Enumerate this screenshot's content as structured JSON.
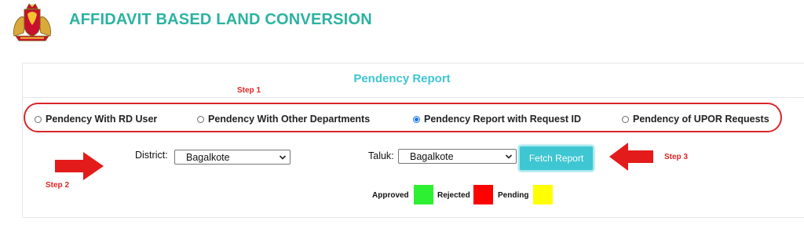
{
  "header": {
    "title": "AFFIDAVIT BASED LAND CONVERSION",
    "emblem_icon": "state-emblem-icon"
  },
  "report": {
    "title": "Pendency Report",
    "steps": {
      "step1": "Step 1",
      "step2": "Step 2",
      "step3": "Step 3"
    },
    "options": [
      {
        "label": "Pendency With RD User",
        "checked": false
      },
      {
        "label": "Pendency With Other Departments",
        "checked": false
      },
      {
        "label": "Pendency Report with Request ID",
        "checked": true
      },
      {
        "label": "Pendency of UPOR Requests",
        "checked": false
      }
    ],
    "district": {
      "label": "District:",
      "value": "Bagalkote"
    },
    "taluk": {
      "label": "Taluk:",
      "value": "Bagalkote"
    },
    "fetch_button": "Fetch Report"
  },
  "legend": {
    "approved": {
      "label": "Approved",
      "color": "#2ef032"
    },
    "rejected": {
      "label": "Rejected",
      "color": "#ff0000"
    },
    "pending": {
      "label": "Pending",
      "color": "#ffff00"
    }
  },
  "colors": {
    "title_teal": "#2bb3a0",
    "accent_cyan": "#3ec6d2",
    "annotation_red": "#e02424"
  }
}
